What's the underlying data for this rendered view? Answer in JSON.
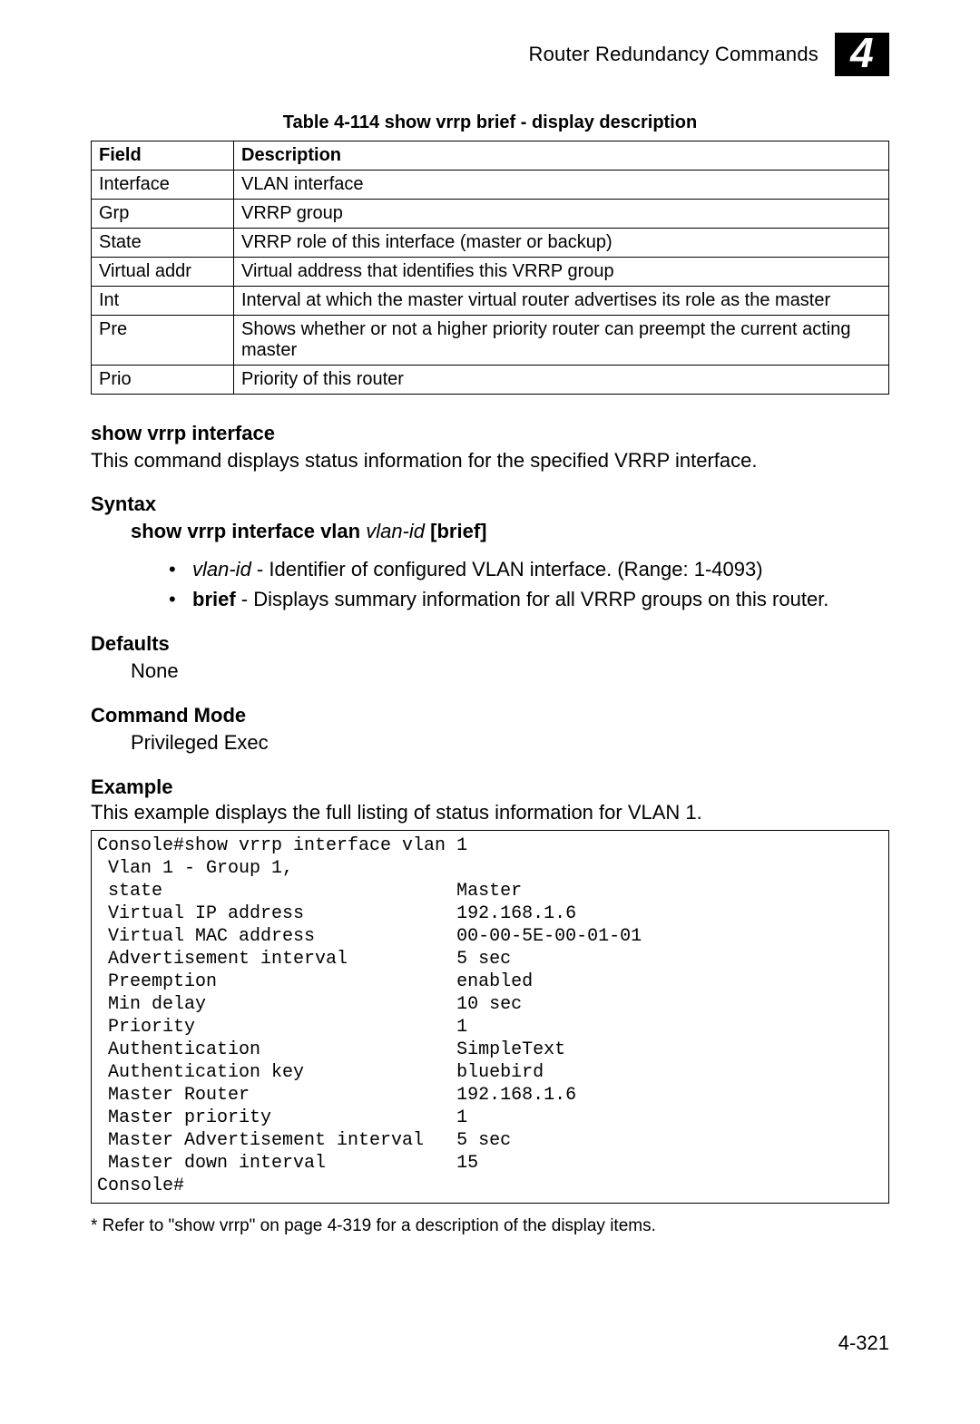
{
  "header": {
    "title": "Router Redundancy Commands",
    "chapter_number": "4"
  },
  "table": {
    "caption": "Table 4-114   show vrrp brief - display description",
    "headers": {
      "field": "Field",
      "description": "Description"
    },
    "rows": [
      {
        "field": "Interface",
        "description": "VLAN interface"
      },
      {
        "field": "Grp",
        "description": "VRRP group"
      },
      {
        "field": "State",
        "description": "VRRP role of this interface (master or backup)"
      },
      {
        "field": "Virtual addr",
        "description": "Virtual address that identifies this VRRP group"
      },
      {
        "field": "Int",
        "description": "Interval at which the master virtual router advertises its role as the master"
      },
      {
        "field": "Pre",
        "description": "Shows whether or not a higher priority router can preempt the current acting master"
      },
      {
        "field": "Prio",
        "description": "Priority of this router"
      }
    ]
  },
  "cmd": {
    "name": "show vrrp interface",
    "description": "This command displays status information for the specified VRRP interface."
  },
  "syntax": {
    "label": "Syntax",
    "line_bold1": "show vrrp interface vlan ",
    "line_italic": "vlan-id",
    "line_bold2": " [",
    "line_bold3": "brief",
    "line_bold4": "]",
    "bullets": [
      {
        "italic": "vlan-id",
        "rest": " - Identifier of configured VLAN interface. (Range: 1-4093)"
      },
      {
        "bold": "brief",
        "rest": " - Displays summary information for all VRRP groups on this router."
      }
    ]
  },
  "defaults": {
    "label": "Defaults",
    "value": "None"
  },
  "mode": {
    "label": "Command Mode",
    "value": "Privileged Exec"
  },
  "example": {
    "label": "Example",
    "intro": "This example displays the full listing of status information for VLAN 1.",
    "code": "Console#show vrrp interface vlan 1\n Vlan 1 - Group 1,\n state                           Master\n Virtual IP address              192.168.1.6\n Virtual MAC address             00-00-5E-00-01-01\n Advertisement interval          5 sec\n Preemption                      enabled\n Min delay                       10 sec\n Priority                        1\n Authentication                  SimpleText\n Authentication key              bluebird\n Master Router                   192.168.1.6\n Master priority                 1\n Master Advertisement interval   5 sec\n Master down interval            15\nConsole#"
  },
  "footnote": "* Refer to \"show vrrp\" on page 4-319 for a description of the display items.",
  "page_number": "4-321"
}
